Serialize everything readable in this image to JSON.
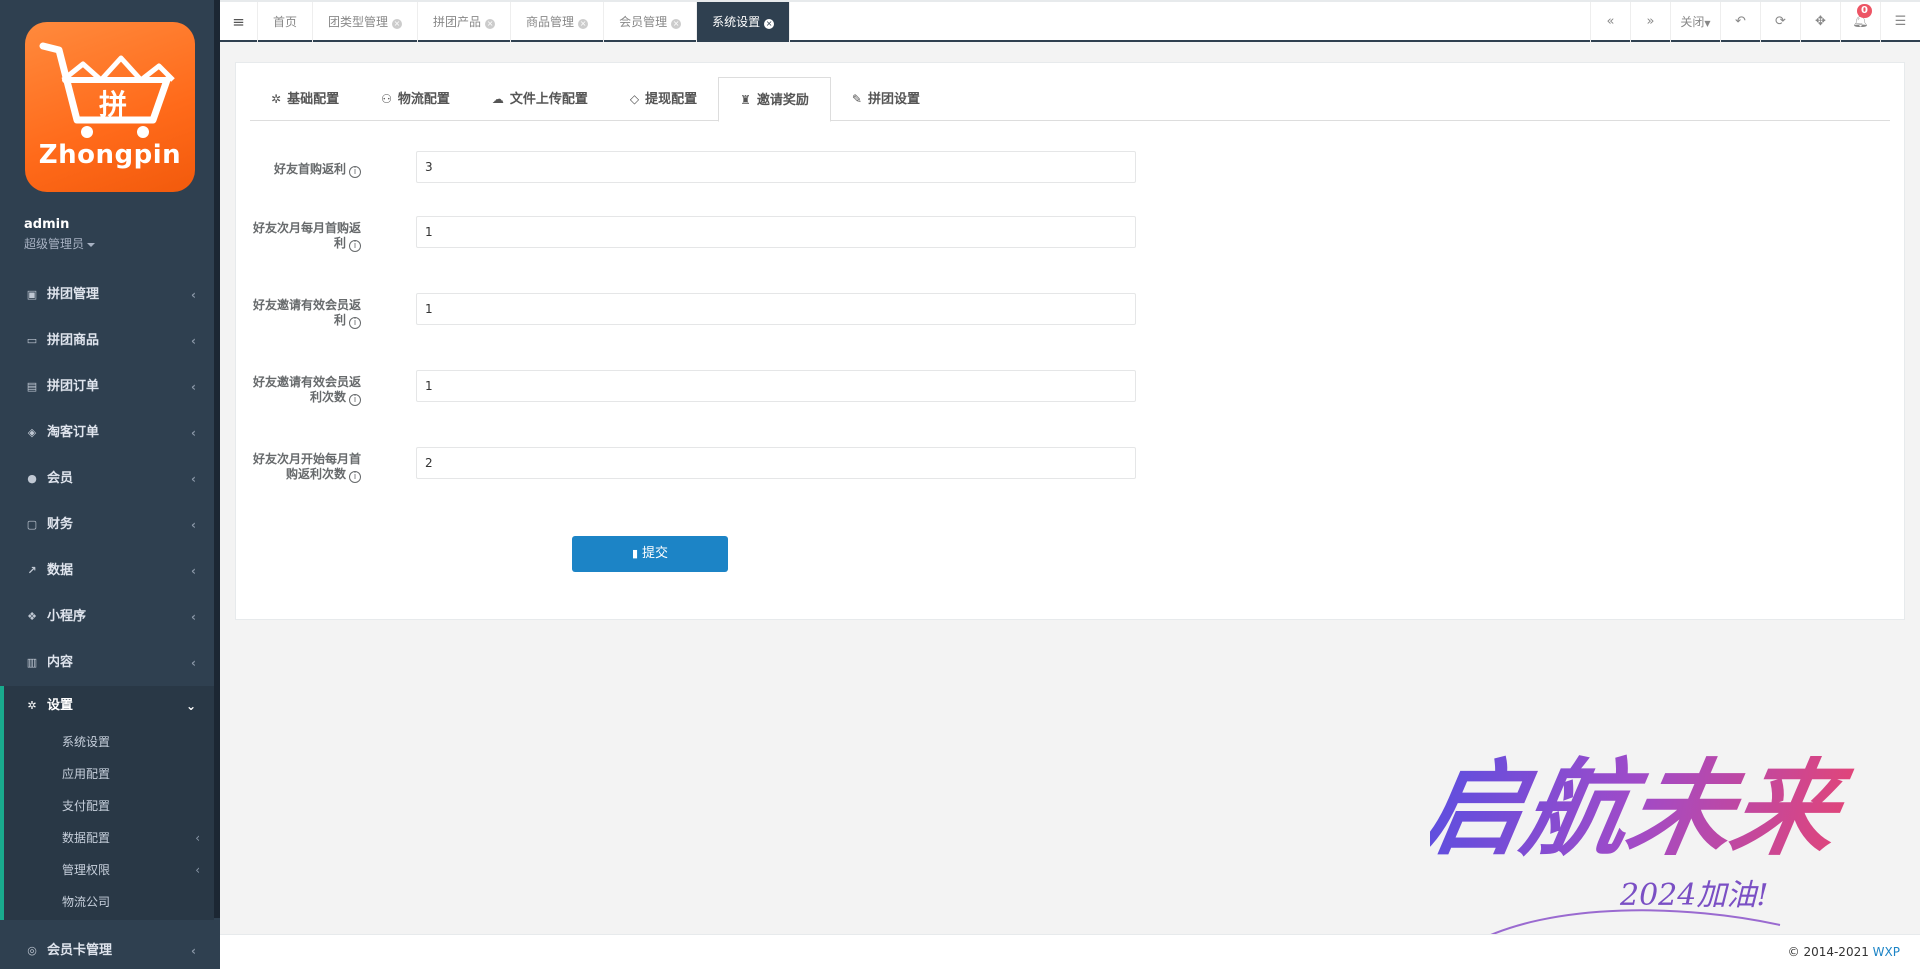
{
  "brand": {
    "logo_text": "Zhongpin",
    "logo_glyph": "拼"
  },
  "user": {
    "name": "admin",
    "role": "超级管理员"
  },
  "sidebar": {
    "items": [
      {
        "label": "拼团管理",
        "icon": "train-icon"
      },
      {
        "label": "拼团商品",
        "icon": "laptop-icon"
      },
      {
        "label": "拼团订单",
        "icon": "list-icon"
      },
      {
        "label": "淘客订单",
        "icon": "cube-icon"
      },
      {
        "label": "会员",
        "icon": "user-icon"
      },
      {
        "label": "财务",
        "icon": "money-icon"
      },
      {
        "label": "数据",
        "icon": "chart-icon"
      },
      {
        "label": "小程序",
        "icon": "cubes-icon"
      },
      {
        "label": "内容",
        "icon": "book-icon"
      }
    ],
    "active": {
      "label": "设置",
      "icon": "gear-icon"
    },
    "sub_items": [
      {
        "label": "系统设置"
      },
      {
        "label": "应用配置"
      },
      {
        "label": "支付配置"
      },
      {
        "label": "数据配置"
      },
      {
        "label": "管理权限"
      },
      {
        "label": "物流公司"
      }
    ],
    "after": {
      "label": "会员卡管理",
      "icon": "card-icon"
    }
  },
  "topbar": {
    "tabs": [
      {
        "label": "首页"
      },
      {
        "label": "团类型管理"
      },
      {
        "label": "拼团产品"
      },
      {
        "label": "商品管理"
      },
      {
        "label": "会员管理"
      },
      {
        "label": "系统设置"
      }
    ],
    "close_label": "关闭",
    "notification_count": "0"
  },
  "settings_tabs": [
    {
      "label": "基础配置",
      "icon": "gear-icon"
    },
    {
      "label": "物流配置",
      "icon": "motorcycle-icon"
    },
    {
      "label": "文件上传配置",
      "icon": "cloud-upload-icon"
    },
    {
      "label": "提现配置",
      "icon": "diamond-icon"
    },
    {
      "label": "邀请奖励",
      "icon": "invite-icon"
    },
    {
      "label": "拼团设置",
      "icon": "brush-icon"
    }
  ],
  "form": {
    "fields": [
      {
        "label_line1": "好友首购返利",
        "label_line2": "",
        "value": "3"
      },
      {
        "label_line1": "好友次月每月首购返",
        "label_line2": "利",
        "value": "1"
      },
      {
        "label_line1": "好友邀请有效会员返",
        "label_line2": "利",
        "value": "1"
      },
      {
        "label_line1": "好友邀请有效会员返",
        "label_line2": "利次数",
        "value": "1"
      },
      {
        "label_line1": "好友次月开始每月首",
        "label_line2": "购返利次数",
        "value": "2"
      }
    ],
    "submit_label": "提交"
  },
  "footer": {
    "copyright": "© 2014-2021 ",
    "link": "WXP"
  },
  "watermark": {
    "line1": "启航未来",
    "line2": "2024加油!"
  },
  "colors": {
    "sidebar_bg": "#2f4050",
    "accent": "#1c84c6",
    "active_border": "#19aa8d",
    "logo_orange": "#ff6a1a"
  }
}
